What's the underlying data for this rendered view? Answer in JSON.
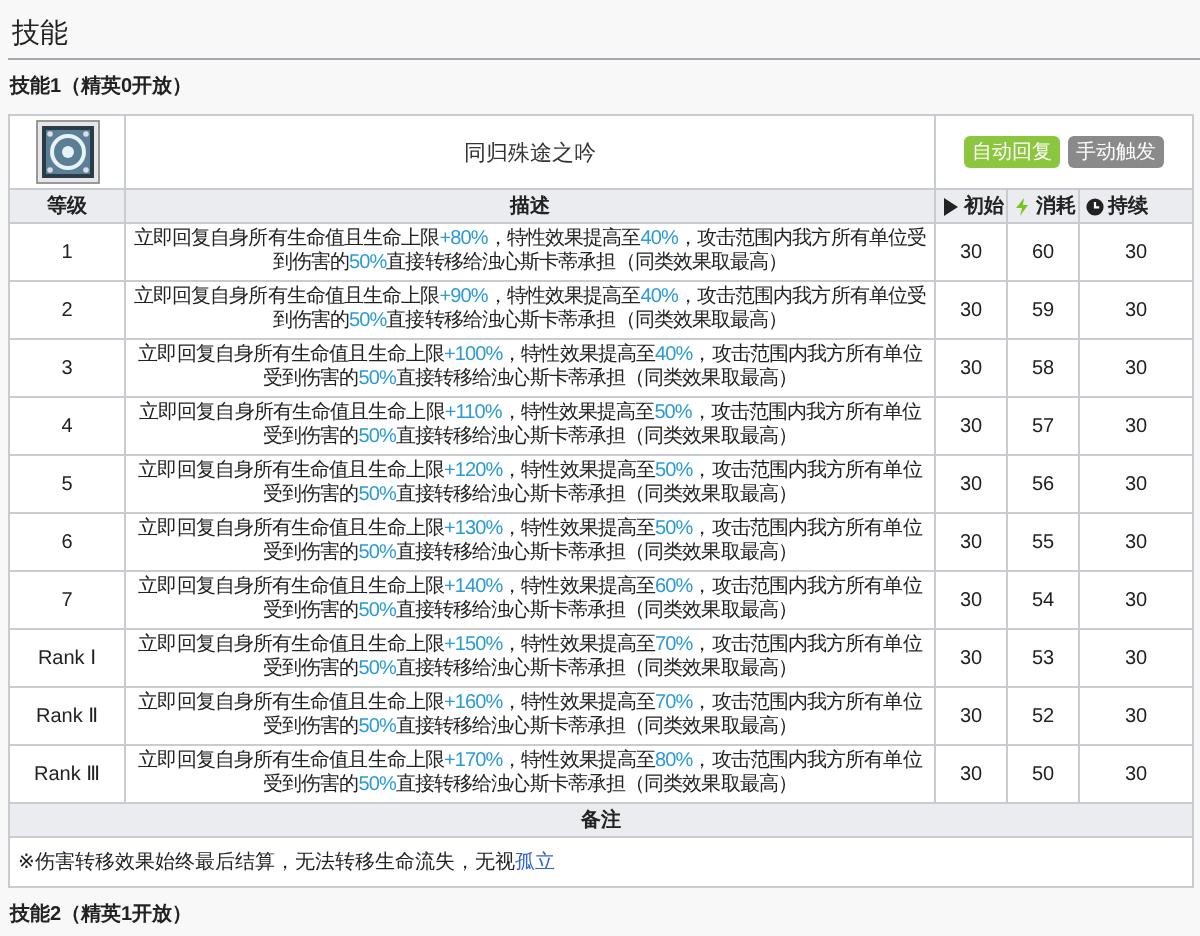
{
  "section_title": "技能",
  "skill_heading": "技能1（精英0开放）",
  "skill": {
    "name": "同归殊途之吟",
    "tags": [
      {
        "label": "自动回复",
        "color": "#8cc63f"
      },
      {
        "label": "手动触发",
        "color": "#8a8a8a"
      }
    ]
  },
  "columns": [
    "等级",
    "描述",
    "初始",
    "消耗",
    "持续"
  ],
  "rows": [
    {
      "level": "1",
      "description": [
        {
          "text": "立即回复自身所有生命值且生命上限",
          "highlight": false
        },
        {
          "text": "+80%",
          "highlight": true
        },
        {
          "text": "，特性效果提高至",
          "highlight": false
        },
        {
          "text": "40%",
          "highlight": true
        },
        {
          "text": "，攻击范围内我方所有单位受到伤害的",
          "highlight": false
        },
        {
          "text": "50%",
          "highlight": true
        },
        {
          "text": "直接转移给浊心斯卡蒂承担（同类效果取最高）",
          "highlight": false
        }
      ],
      "initial": "30",
      "cost": "60",
      "duration": "30"
    },
    {
      "level": "2",
      "description": [
        {
          "text": "立即回复自身所有生命值且生命上限",
          "highlight": false
        },
        {
          "text": "+90%",
          "highlight": true
        },
        {
          "text": "，特性效果提高至",
          "highlight": false
        },
        {
          "text": "40%",
          "highlight": true
        },
        {
          "text": "，攻击范围内我方所有单位受到伤害的",
          "highlight": false
        },
        {
          "text": "50%",
          "highlight": true
        },
        {
          "text": "直接转移给浊心斯卡蒂承担（同类效果取最高）",
          "highlight": false
        }
      ],
      "initial": "30",
      "cost": "59",
      "duration": "30"
    },
    {
      "level": "3",
      "description": [
        {
          "text": "立即回复自身所有生命值且生命上限",
          "highlight": false
        },
        {
          "text": "+100%",
          "highlight": true
        },
        {
          "text": "，特性效果提高至",
          "highlight": false
        },
        {
          "text": "40%",
          "highlight": true
        },
        {
          "text": "，攻击范围内我方所有单位受到伤害的",
          "highlight": false
        },
        {
          "text": "50%",
          "highlight": true
        },
        {
          "text": "直接转移给浊心斯卡蒂承担（同类效果取最高）",
          "highlight": false
        }
      ],
      "initial": "30",
      "cost": "58",
      "duration": "30"
    },
    {
      "level": "4",
      "description": [
        {
          "text": "立即回复自身所有生命值且生命上限",
          "highlight": false
        },
        {
          "text": "+110%",
          "highlight": true
        },
        {
          "text": "，特性效果提高至",
          "highlight": false
        },
        {
          "text": "50%",
          "highlight": true
        },
        {
          "text": "，攻击范围内我方所有单位受到伤害的",
          "highlight": false
        },
        {
          "text": "50%",
          "highlight": true
        },
        {
          "text": "直接转移给浊心斯卡蒂承担（同类效果取最高）",
          "highlight": false
        }
      ],
      "initial": "30",
      "cost": "57",
      "duration": "30"
    },
    {
      "level": "5",
      "description": [
        {
          "text": "立即回复自身所有生命值且生命上限",
          "highlight": false
        },
        {
          "text": "+120%",
          "highlight": true
        },
        {
          "text": "，特性效果提高至",
          "highlight": false
        },
        {
          "text": "50%",
          "highlight": true
        },
        {
          "text": "，攻击范围内我方所有单位受到伤害的",
          "highlight": false
        },
        {
          "text": "50%",
          "highlight": true
        },
        {
          "text": "直接转移给浊心斯卡蒂承担（同类效果取最高）",
          "highlight": false
        }
      ],
      "initial": "30",
      "cost": "56",
      "duration": "30"
    },
    {
      "level": "6",
      "description": [
        {
          "text": "立即回复自身所有生命值且生命上限",
          "highlight": false
        },
        {
          "text": "+130%",
          "highlight": true
        },
        {
          "text": "，特性效果提高至",
          "highlight": false
        },
        {
          "text": "50%",
          "highlight": true
        },
        {
          "text": "，攻击范围内我方所有单位受到伤害的",
          "highlight": false
        },
        {
          "text": "50%",
          "highlight": true
        },
        {
          "text": "直接转移给浊心斯卡蒂承担（同类效果取最高）",
          "highlight": false
        }
      ],
      "initial": "30",
      "cost": "55",
      "duration": "30"
    },
    {
      "level": "7",
      "description": [
        {
          "text": "立即回复自身所有生命值且生命上限",
          "highlight": false
        },
        {
          "text": "+140%",
          "highlight": true
        },
        {
          "text": "，特性效果提高至",
          "highlight": false
        },
        {
          "text": "60%",
          "highlight": true
        },
        {
          "text": "，攻击范围内我方所有单位受到伤害的",
          "highlight": false
        },
        {
          "text": "50%",
          "highlight": true
        },
        {
          "text": "直接转移给浊心斯卡蒂承担（同类效果取最高）",
          "highlight": false
        }
      ],
      "initial": "30",
      "cost": "54",
      "duration": "30"
    },
    {
      "level": "Rank Ⅰ",
      "description": [
        {
          "text": "立即回复自身所有生命值且生命上限",
          "highlight": false
        },
        {
          "text": "+150%",
          "highlight": true
        },
        {
          "text": "，特性效果提高至",
          "highlight": false
        },
        {
          "text": "70%",
          "highlight": true
        },
        {
          "text": "，攻击范围内我方所有单位受到伤害的",
          "highlight": false
        },
        {
          "text": "50%",
          "highlight": true
        },
        {
          "text": "直接转移给浊心斯卡蒂承担（同类效果取最高）",
          "highlight": false
        }
      ],
      "initial": "30",
      "cost": "53",
      "duration": "30"
    },
    {
      "level": "Rank Ⅱ",
      "description": [
        {
          "text": "立即回复自身所有生命值且生命上限",
          "highlight": false
        },
        {
          "text": "+160%",
          "highlight": true
        },
        {
          "text": "，特性效果提高至",
          "highlight": false
        },
        {
          "text": "70%",
          "highlight": true
        },
        {
          "text": "，攻击范围内我方所有单位受到伤害的",
          "highlight": false
        },
        {
          "text": "50%",
          "highlight": true
        },
        {
          "text": "直接转移给浊心斯卡蒂承担（同类效果取最高）",
          "highlight": false
        }
      ],
      "initial": "30",
      "cost": "52",
      "duration": "30"
    },
    {
      "level": "Rank Ⅲ",
      "description": [
        {
          "text": "立即回复自身所有生命值且生命上限",
          "highlight": false
        },
        {
          "text": "+170%",
          "highlight": true
        },
        {
          "text": "，特性效果提高至",
          "highlight": false
        },
        {
          "text": "80%",
          "highlight": true
        },
        {
          "text": "，攻击范围内我方所有单位受到伤害的",
          "highlight": false
        },
        {
          "text": "50%",
          "highlight": true
        },
        {
          "text": "直接转移给浊心斯卡蒂承担（同类效果取最高）",
          "highlight": false
        }
      ],
      "initial": "30",
      "cost": "50",
      "duration": "30"
    }
  ],
  "remarks": {
    "title": "备注",
    "text": "※伤害转移效果始终最后结算，无法转移生命流失，无视",
    "link": "孤立"
  },
  "next_skill_heading": "技能2（精英1开放）"
}
